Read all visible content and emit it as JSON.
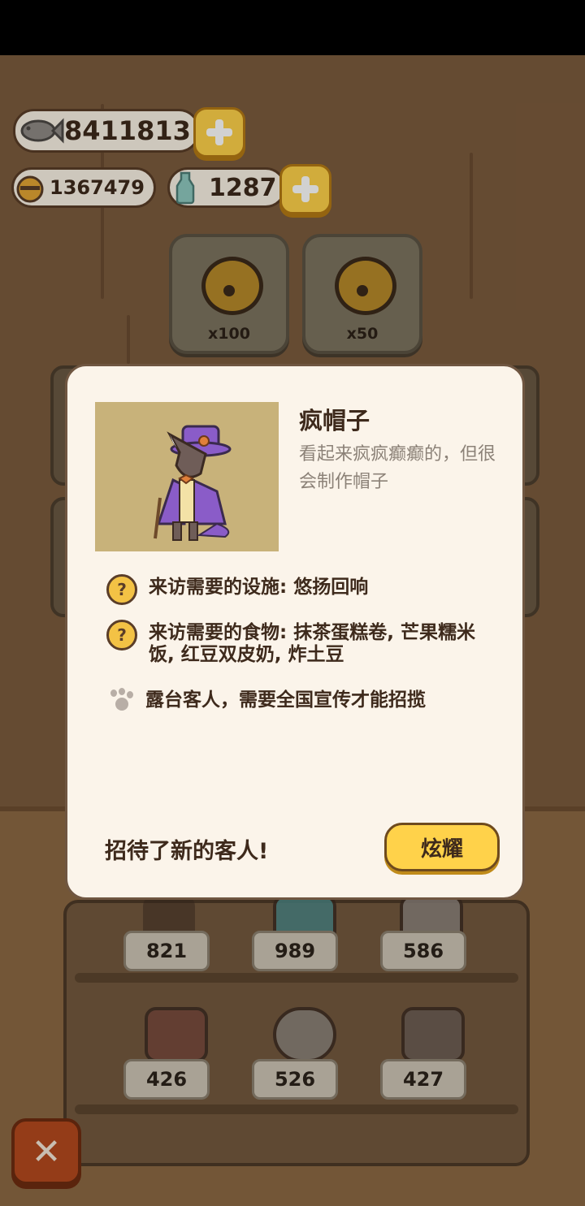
{
  "currency": {
    "fish": "8411813",
    "bells": "1367479",
    "bottle": "1287"
  },
  "bell_packs": [
    {
      "qty": "x100"
    },
    {
      "qty": "x50"
    }
  ],
  "shelf_counts": [
    "821",
    "989",
    "586",
    "426",
    "526",
    "427"
  ],
  "modal": {
    "name": "疯帽子",
    "description": "看起来疯疯癫癫的，但很会制作帽子",
    "req_facility": "来访需要的设施: 悠扬回响",
    "req_food": "来访需要的食物: 抹茶蛋糕卷, 芒果糯米饭, 红豆双皮奶, 炸土豆",
    "req_terrace": "露台客人，需要全国宣传才能招揽",
    "footer": "招待了新的客人!",
    "button_label": "炫耀"
  },
  "icons": {
    "question": "?",
    "close": "✕"
  },
  "colors": {
    "accent_yellow": "#ffd24a",
    "close_red": "#b54a1e",
    "modal_bg": "#fbf4ea"
  }
}
